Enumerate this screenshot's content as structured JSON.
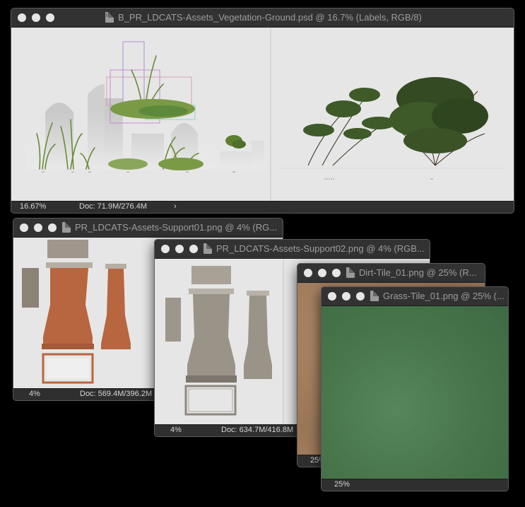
{
  "windows": {
    "main": {
      "title": "B_PR_LDCATS-Assets_Vegetation-Ground.psd @ 16.7% (Labels, RGB/8)",
      "zoom": "16.67%",
      "doc": "Doc: 71.9M/276.4M",
      "status_arrow": "›",
      "icon_badge": "Ps"
    },
    "support01": {
      "title": "PR_LDCATS-Assets-Support01.png @ 4% (RG...",
      "zoom": "4%",
      "doc": "Doc: 569.4M/396.2M"
    },
    "support02": {
      "title": "PR_LDCATS-Assets-Support02.png @ 4% (RGB...",
      "zoom": "4%",
      "doc": "Doc: 634.7M/416.8M"
    },
    "dirt": {
      "title": "Dirt-Tile_01.png @ 25% (R...",
      "zoom": "25%"
    },
    "grass": {
      "title": "Grass-Tile_01.png @ 25% (...",
      "zoom": "25%"
    }
  },
  "colors": {
    "chrome": "#323232",
    "canvas_grey": "#e6e6e6",
    "brick": "#b8663f",
    "grass_tile": "#4a7a4c",
    "dirt_tile": "#a88262"
  }
}
